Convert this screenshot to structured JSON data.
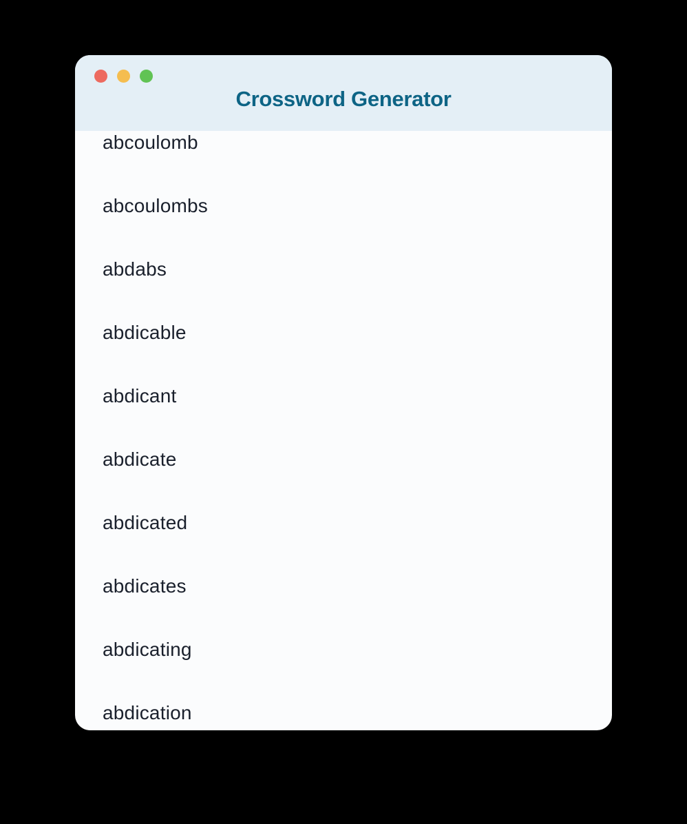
{
  "window": {
    "title": "Crossword Generator"
  },
  "words": [
    "abcoulomb",
    "abcoulombs",
    "abdabs",
    "abdicable",
    "abdicant",
    "abdicate",
    "abdicated",
    "abdicates",
    "abdicating",
    "abdication"
  ]
}
